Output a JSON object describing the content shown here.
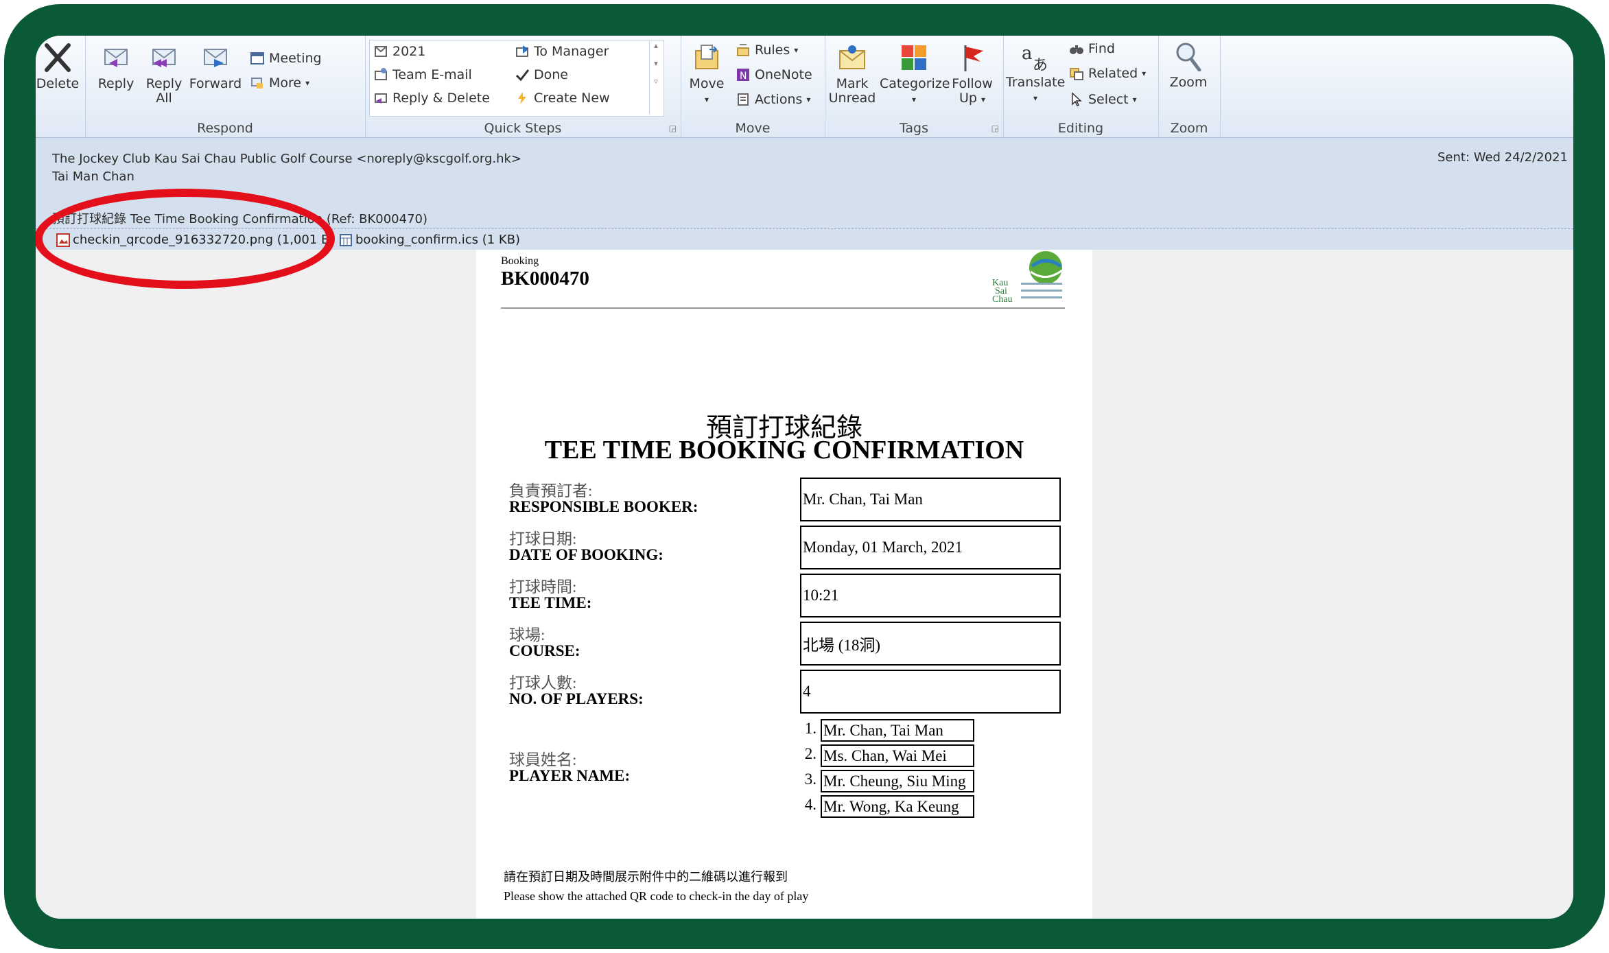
{
  "ribbon": {
    "delete": {
      "label": "Delete",
      "icon": "delete-x-icon"
    },
    "respond": {
      "group_label": "Respond",
      "reply": "Reply",
      "reply_all_1": "Reply",
      "reply_all_2": "All",
      "forward": "Forward",
      "meeting": "Meeting",
      "more": "More"
    },
    "quick_steps": {
      "group_label": "Quick Steps",
      "items": [
        "2021",
        "Team E-mail",
        "Reply & Delete",
        "To Manager",
        "Done",
        "Create New"
      ]
    },
    "move": {
      "group_label": "Move",
      "move": "Move",
      "rules": "Rules",
      "onenote": "OneNote",
      "actions": "Actions"
    },
    "tags": {
      "group_label": "Tags",
      "mark_unread_1": "Mark",
      "mark_unread_2": "Unread",
      "categorize": "Categorize",
      "follow_up_1": "Follow",
      "follow_up_2": "Up"
    },
    "editing": {
      "group_label": "Editing",
      "translate": "Translate",
      "find": "Find",
      "related": "Related",
      "select": "Select"
    },
    "zoom": {
      "group_label": "Zoom",
      "zoom": "Zoom"
    }
  },
  "email": {
    "from": "The Jockey Club Kau Sai Chau Public Golf Course <noreply@kscgolf.org.hk>",
    "to": "Tai Man Chan",
    "sent": "Sent:  Wed 24/2/2021",
    "subject": "預訂打球紀錄 Tee Time Booking Confirmation (Ref: BK000470)",
    "attachments": [
      {
        "name": "checkin_qrcode_916332720.png (1,001 B)",
        "icon": "image-file-icon"
      },
      {
        "name": "booking_confirm.ics (1 KB)",
        "icon": "calendar-file-icon"
      }
    ]
  },
  "doc": {
    "booking_small": "Booking",
    "booking_id": "BK000470",
    "title_cn": "預訂打球紀錄",
    "title_en": "TEE TIME BOOKING CONFIRMATION",
    "fields": [
      {
        "cn": "負責預訂者:",
        "en": "RESPONSIBLE BOOKER:",
        "value": "Mr. Chan, Tai Man"
      },
      {
        "cn": "打球日期:",
        "en": "DATE OF BOOKING:",
        "value": "Monday, 01 March, 2021"
      },
      {
        "cn": "打球時間:",
        "en": "TEE TIME:",
        "value": "10:21"
      },
      {
        "cn": "球場:",
        "en": "COURSE:",
        "value": "北場 (18洞)"
      },
      {
        "cn": "打球人數:",
        "en": "NO. OF PLAYERS:",
        "value": "4"
      }
    ],
    "player_label_cn": "球員姓名:",
    "player_label_en": "PLAYER NAME:",
    "players": [
      {
        "num": "1.",
        "name": "Mr. Chan, Tai Man"
      },
      {
        "num": "2.",
        "name": "Ms. Chan, Wai Mei"
      },
      {
        "num": "3.",
        "name": "Mr. Cheung, Siu Ming"
      },
      {
        "num": "4.",
        "name": "Mr. Wong, Ka Keung"
      }
    ],
    "note_cn": "請在預訂日期及時間展示附件中的二維碼以進行報到",
    "note_en": "Please show the attached QR code to check-in the day of play",
    "logo_text": "Kau Sai Chau"
  },
  "colors": {
    "frame": "#0b5a37",
    "highlight_circle": "#e3101c",
    "header_bg": "#d4e0ee"
  }
}
